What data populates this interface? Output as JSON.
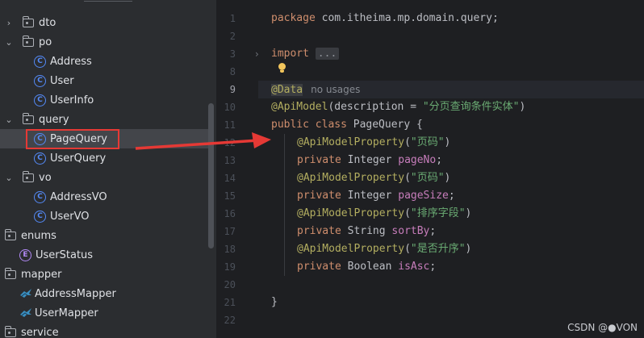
{
  "tree": {
    "items": [
      {
        "label": "dto",
        "kind": "folder",
        "expanded": false
      },
      {
        "label": "po",
        "kind": "folder",
        "expanded": true
      },
      {
        "label": "Address",
        "kind": "class"
      },
      {
        "label": "User",
        "kind": "class"
      },
      {
        "label": "UserInfo",
        "kind": "class"
      },
      {
        "label": "query",
        "kind": "folder",
        "expanded": true
      },
      {
        "label": "PageQuery",
        "kind": "class",
        "selected": true
      },
      {
        "label": "UserQuery",
        "kind": "class"
      },
      {
        "label": "vo",
        "kind": "folder",
        "expanded": true
      },
      {
        "label": "AddressVO",
        "kind": "class"
      },
      {
        "label": "UserVO",
        "kind": "class"
      },
      {
        "label": "enums",
        "kind": "folder"
      },
      {
        "label": "UserStatus",
        "kind": "enum"
      },
      {
        "label": "mapper",
        "kind": "folder"
      },
      {
        "label": "AddressMapper",
        "kind": "mapper"
      },
      {
        "label": "UserMapper",
        "kind": "mapper"
      },
      {
        "label": "service",
        "kind": "folder"
      }
    ],
    "class_glyph": "C",
    "enum_glyph": "E"
  },
  "editor": {
    "line_numbers": [
      "1",
      "2",
      "3",
      "8",
      "9",
      "10",
      "11",
      "12",
      "13",
      "14",
      "15",
      "16",
      "17",
      "18",
      "19",
      "20",
      "21",
      "22"
    ],
    "l1": {
      "kw": "package",
      "rest": " com.itheima.mp.domain.query;"
    },
    "l3": {
      "kw": "import",
      "folded": "..."
    },
    "l9": {
      "ann": "@Data",
      "hint": "no usages"
    },
    "l10": {
      "ann": "@ApiModel",
      "pre": "(description = ",
      "str": "\"分页查询条件实体\"",
      "post": ")"
    },
    "l11": {
      "kw": "public class",
      "name": " PageQuery",
      "post": " {"
    },
    "l12": {
      "ann": "@ApiModelProperty",
      "str": "\"页码\""
    },
    "l13": {
      "kw": "private",
      "type": " Integer ",
      "field": "pageNo",
      "post": ";"
    },
    "l14": {
      "ann": "@ApiModelProperty",
      "str": "\"页码\""
    },
    "l15": {
      "kw": "private",
      "type": " Integer ",
      "field": "pageSize",
      "post": ";"
    },
    "l16": {
      "ann": "@ApiModelProperty",
      "str": "\"排序字段\""
    },
    "l17": {
      "kw": "private",
      "type": " String ",
      "field": "sortBy",
      "post": ";"
    },
    "l18": {
      "ann": "@ApiModelProperty",
      "str": "\"是否升序\""
    },
    "l19": {
      "kw": "private",
      "type": " Boolean ",
      "field": "isAsc",
      "post": ";"
    },
    "l21": {
      "text": "}"
    }
  },
  "watermark": "CSDN @●VON",
  "colors": {
    "highlight": "#e53935",
    "keyword": "#cf8e6d",
    "annotation": "#b3ae60",
    "string": "#6aab73",
    "field": "#c77dbb"
  }
}
